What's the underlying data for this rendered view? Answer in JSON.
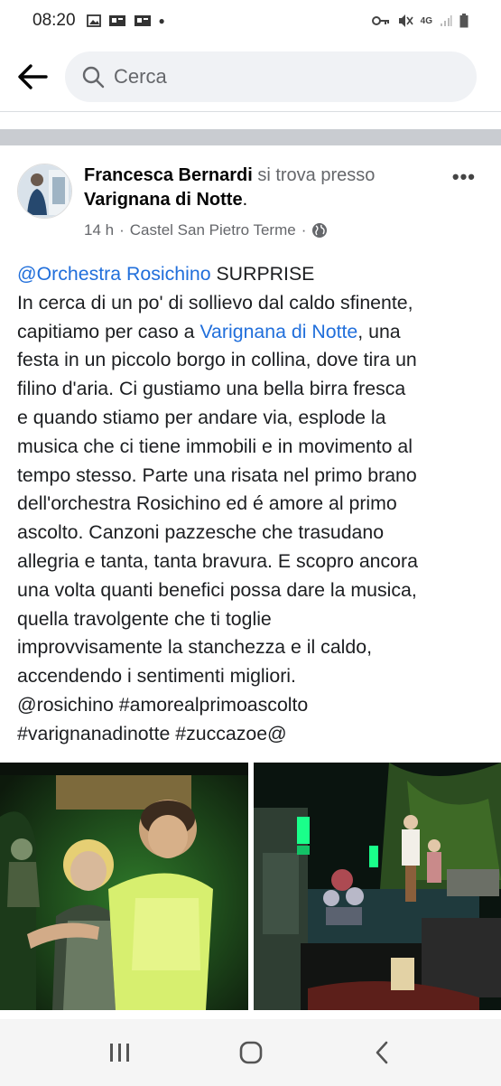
{
  "status_bar": {
    "time": "08:20",
    "left_icons": [
      "image-icon",
      "photo-icon",
      "photo-icon",
      "dot-icon"
    ],
    "right_icons": [
      "key-icon",
      "mute-icon",
      "network-4g-icon",
      "signal-icon",
      "battery-icon"
    ],
    "network_label": "4G"
  },
  "search": {
    "placeholder": "Cerca"
  },
  "post": {
    "author": "Francesca Bernardi",
    "action": "si trova presso",
    "place": "Varignana di Notte",
    "place_suffix": ".",
    "time_ago": "14 h",
    "separator": "·",
    "location": "Castel San Pietro Terme",
    "privacy_icon": "globe-icon",
    "more_label": "•••",
    "text": {
      "line1_mention": "@Orchestra Rosichino",
      "line1_rest": " SURPRISE",
      "line2": "In cerca di un po' di sollievo dal caldo sfinente,",
      "line3_pre": "capitiamo per caso a ",
      "line3_link": "Varignana di Notte",
      "line3_post": ", una",
      "line4": "festa in un piccolo borgo in collina, dove tira un",
      "line5": "filino d'aria. Ci gustiamo una bella birra fresca",
      "line6": "e quando stiamo per andare via, esplode la",
      "line7": "musica che ci tiene immobili e in movimento al",
      "line8": "tempo stesso. Parte una risata nel primo brano",
      "line9": "dell'orchestra Rosichino ed é amore al primo",
      "line10": "ascolto. Canzoni pazzesche che trasudano",
      "line11": "allegria e tanta, tanta bravura. E scopro ancora",
      "line12": "una volta quanti benefici possa dare la musica,",
      "line13": "quella travolgente che ti toglie",
      "line14": "improvvisamente la stanchezza e il caldo,",
      "line15": "accendendo i sentimenti migliori.",
      "line16": "@rosichino  #amorealprimoascolto",
      "line17": "#varignanadinotte #zuccazoe@"
    },
    "photos": [
      {
        "name": "photo-couple-selfie"
      },
      {
        "name": "photo-band-stage"
      }
    ]
  },
  "nav": {
    "recents_icon": "recents-icon",
    "home_icon": "home-icon",
    "back_icon": "back-nav-icon"
  },
  "colors": {
    "link": "#216fdb",
    "secondary_text": "#65676b",
    "search_bg": "#f0f2f5",
    "divider": "#c9ccd1"
  }
}
